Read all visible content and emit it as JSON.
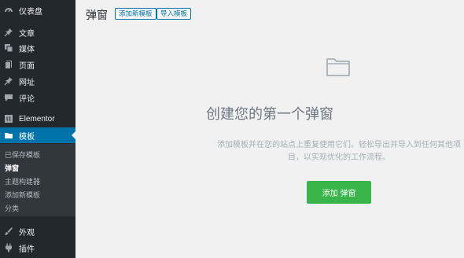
{
  "sidebar": {
    "items": [
      {
        "label": "仪表盘",
        "icon": "dashboard-icon"
      },
      {
        "label": "文章",
        "icon": "pin-icon"
      },
      {
        "label": "媒体",
        "icon": "media-icon"
      },
      {
        "label": "页面",
        "icon": "pages-icon"
      },
      {
        "label": "网址",
        "icon": "pin-icon"
      },
      {
        "label": "评论",
        "icon": "comment-icon"
      },
      {
        "label": "Elementor",
        "icon": "elementor-icon"
      },
      {
        "label": "模板",
        "icon": "folder-icon",
        "active": true
      },
      {
        "label": "外观",
        "icon": "brush-icon"
      },
      {
        "label": "插件",
        "icon": "plugin-icon"
      }
    ],
    "submenu": [
      {
        "label": "已保存模板"
      },
      {
        "label": "弹窗",
        "current": true
      },
      {
        "label": "主题构建器"
      },
      {
        "label": "添加新模板"
      },
      {
        "label": "分类"
      }
    ]
  },
  "header": {
    "title": "弹窗",
    "add_new_label": "添加新模板",
    "import_label": "导入模板"
  },
  "empty_state": {
    "icon": "folder-icon",
    "title": "创建您的第一个弹窗",
    "description": "添加模板并在您的站点上重复使用它们。轻松导出并导入到任何其他项目，以实现优化的工作流程。",
    "button_label": "添加 弹窗"
  },
  "colors": {
    "sidebar_bg": "#23282d",
    "accent": "#0073aa",
    "button_green": "#39b54a"
  }
}
